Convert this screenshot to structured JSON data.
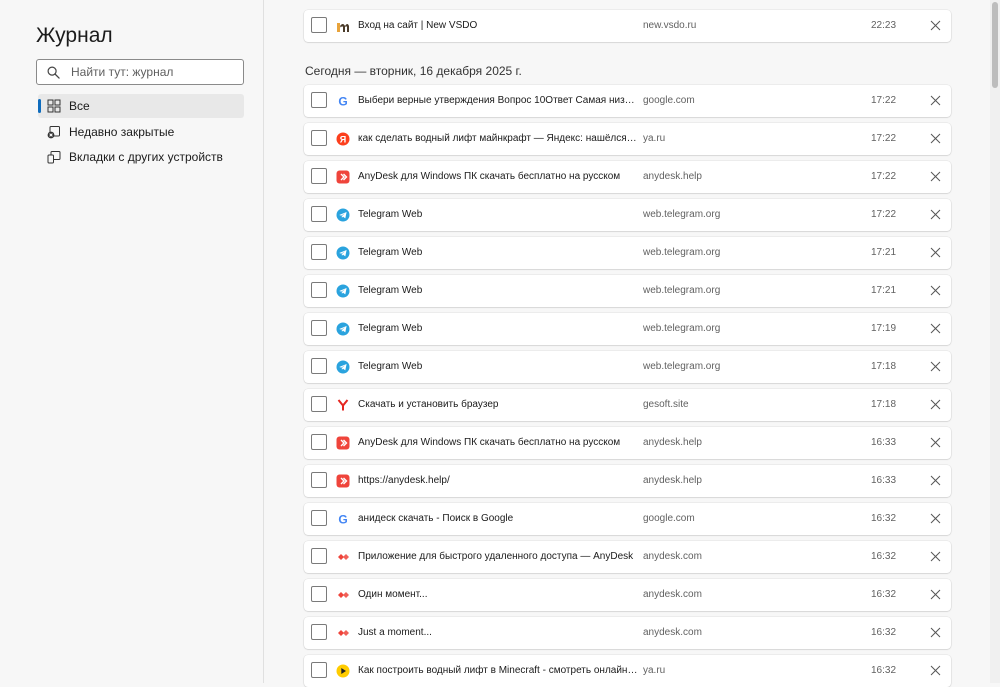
{
  "sidebar": {
    "title": "Журнал",
    "search_placeholder": "Найти тут: журнал",
    "items": [
      {
        "label": "Все",
        "icon": "grid-icon",
        "active": true
      },
      {
        "label": "Недавно закрытые",
        "icon": "recently-closed-icon",
        "active": false
      },
      {
        "label": "Вкладки с других устройств",
        "icon": "devices-tabs-icon",
        "active": false
      }
    ]
  },
  "top_entry": {
    "title": "Вход на сайт | New VSDO",
    "domain": "new.vsdo.ru",
    "time": "22:23",
    "favicon": "vsdo-favicon"
  },
  "date_header": "Сегодня — вторник, 16 декабря 2025 г.",
  "entries": [
    {
      "title": "Выбери верные утверждения Вопрос 10Ответ Самая низкая ...",
      "domain": "google.com",
      "time": "17:22",
      "favicon": "google-favicon"
    },
    {
      "title": "как сделать водный лифт майнкрафт — Яндекс: нашёлся 1 м...",
      "domain": "ya.ru",
      "time": "17:22",
      "favicon": "yandex-favicon"
    },
    {
      "title": "AnyDesk для Windows ПК скачать бесплатно на русском",
      "domain": "anydesk.help",
      "time": "17:22",
      "favicon": "anydesk-help-favicon"
    },
    {
      "title": "Telegram Web",
      "domain": "web.telegram.org",
      "time": "17:22",
      "favicon": "telegram-favicon"
    },
    {
      "title": "Telegram Web",
      "domain": "web.telegram.org",
      "time": "17:21",
      "favicon": "telegram-favicon"
    },
    {
      "title": "Telegram Web",
      "domain": "web.telegram.org",
      "time": "17:21",
      "favicon": "telegram-favicon"
    },
    {
      "title": "Telegram Web",
      "domain": "web.telegram.org",
      "time": "17:19",
      "favicon": "telegram-favicon"
    },
    {
      "title": "Telegram Web",
      "domain": "web.telegram.org",
      "time": "17:18",
      "favicon": "telegram-favicon"
    },
    {
      "title": "Скачать и установить браузер",
      "domain": "gesoft.site",
      "time": "17:18",
      "favicon": "yandex-browser-favicon"
    },
    {
      "title": "AnyDesk для Windows ПК скачать бесплатно на русском",
      "domain": "anydesk.help",
      "time": "16:33",
      "favicon": "anydesk-help-favicon"
    },
    {
      "title": "https://anydesk.help/",
      "domain": "anydesk.help",
      "time": "16:33",
      "favicon": "anydesk-help-favicon"
    },
    {
      "title": "анидеск скачать - Поиск в Google",
      "domain": "google.com",
      "time": "16:32",
      "favicon": "google-favicon"
    },
    {
      "title": "Приложение для быстрого удаленного доступа — AnyDesk",
      "domain": "anydesk.com",
      "time": "16:32",
      "favicon": "anydesk-favicon"
    },
    {
      "title": "Один момент...",
      "domain": "anydesk.com",
      "time": "16:32",
      "favicon": "anydesk-favicon"
    },
    {
      "title": "Just a moment...",
      "domain": "anydesk.com",
      "time": "16:32",
      "favicon": "anydesk-favicon"
    },
    {
      "title": "Как построить водный лифт в Minecraft - смотреть онлайн в...",
      "domain": "ya.ru",
      "time": "16:32",
      "favicon": "yandex-video-favicon"
    }
  ],
  "colors": {
    "accent": "#0f6cbd",
    "google_blue": "#4285f4",
    "telegram": "#2aa3de",
    "anydesk": "#ef443b",
    "yandex": "#fc3f1d"
  }
}
